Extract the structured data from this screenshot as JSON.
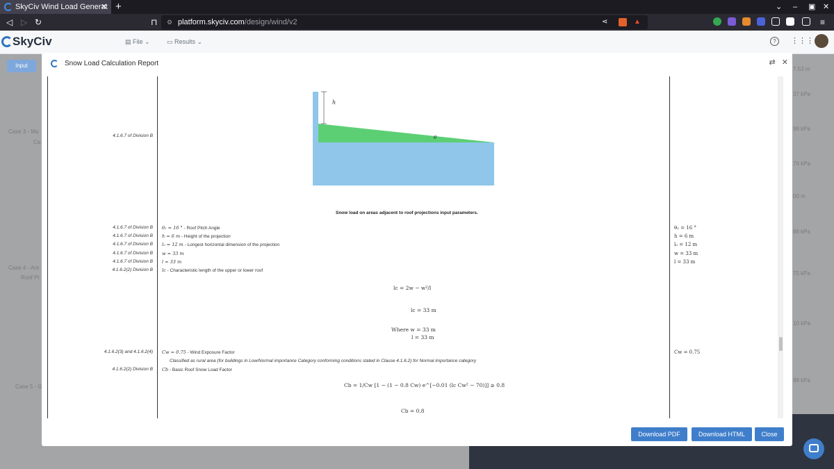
{
  "browser": {
    "tab_title": "SkyCiv Wind Load Generat",
    "url_host": "platform.skyciv.com",
    "url_path": "/design/wind/v2"
  },
  "app": {
    "logo_text": "SkyCiv",
    "menu_file": "File",
    "menu_results": "Results",
    "input_button": "Input",
    "left_items": [
      "Case 3 - Mu",
      "Ca",
      "Case 4 - Are",
      "Roof Pr",
      "Case 5 - G"
    ],
    "right_values": [
      "7.53 m",
      "37 kPa",
      "98 kPa",
      "76 kPa",
      "00 m",
      "88 kPa",
      "75 kPa",
      "10 kPa",
      "98 kPa"
    ]
  },
  "modal": {
    "title": "Snow Load Calculation Report",
    "figure_ref": "4.1.6.7 of Division B",
    "figure_label_h": "h",
    "figure_label_theta": "θ",
    "figure_caption": "Snow load on areas adjacent to roof projections input parameters.",
    "rows": [
      {
        "ref": "4.1.6.7 of Division B",
        "sym": "θ₁ = 16 °",
        "desc": " - Roof Pitch Angle",
        "val": "θ₁ = 16 °"
      },
      {
        "ref": "4.1.6.7 of Division B",
        "sym": "h = 6 m",
        "desc": " - Height of the projection",
        "val": "h = 6 m"
      },
      {
        "ref": "4.1.6.7 of Division B",
        "sym": "l₀ = 12 m",
        "desc": " - Longest horizontal dimension of the projection",
        "val": "l₀ = 12 m"
      },
      {
        "ref": "4.1.6.7 of Division B",
        "sym": "w = 33 m",
        "desc": "",
        "val": "w = 33 m"
      },
      {
        "ref": "4.1.6.7 of Division B",
        "sym": "l = 33 m",
        "desc": "",
        "val": "l = 33 m"
      },
      {
        "ref": "4.1.6.2(2) Division B",
        "sym": "lc",
        "desc": " - Characteristic length of the upper or lower roof",
        "val": ""
      }
    ],
    "eq_lc": "lc = 2w − w²/l",
    "eq_lc_result": "lc = 33 m",
    "where_line1": "Where w = 33 m",
    "where_line2": "l = 33 m",
    "cw_ref": "4.1.6.2(3) and 4.1.6.2(4)",
    "cw_sym": "Cw = 0.75",
    "cw_desc": " - Wind Exposure Factor",
    "cw_val": "Cw = 0.75",
    "cw_note": "Classified as rural area (for buildings in Low/Normal importance Category conforming conditions stated in Clause 4.1.6.2) for Normal importance category",
    "cb_ref": "4.1.6.2(2) Division B",
    "cb_sym": "Cb",
    "cb_desc": " - Basic Roof Snow Load Factor",
    "eq_cb": "Cb = 1/Cw [1 − (1 − 0.8 Cw) e^[−0.01 (lc Cw² − 70)]] ≥ 0.8",
    "eq_cb_result": "Cb = 0.8",
    "btn_pdf": "Download PDF",
    "btn_html": "Download HTML",
    "btn_close": "Close"
  }
}
